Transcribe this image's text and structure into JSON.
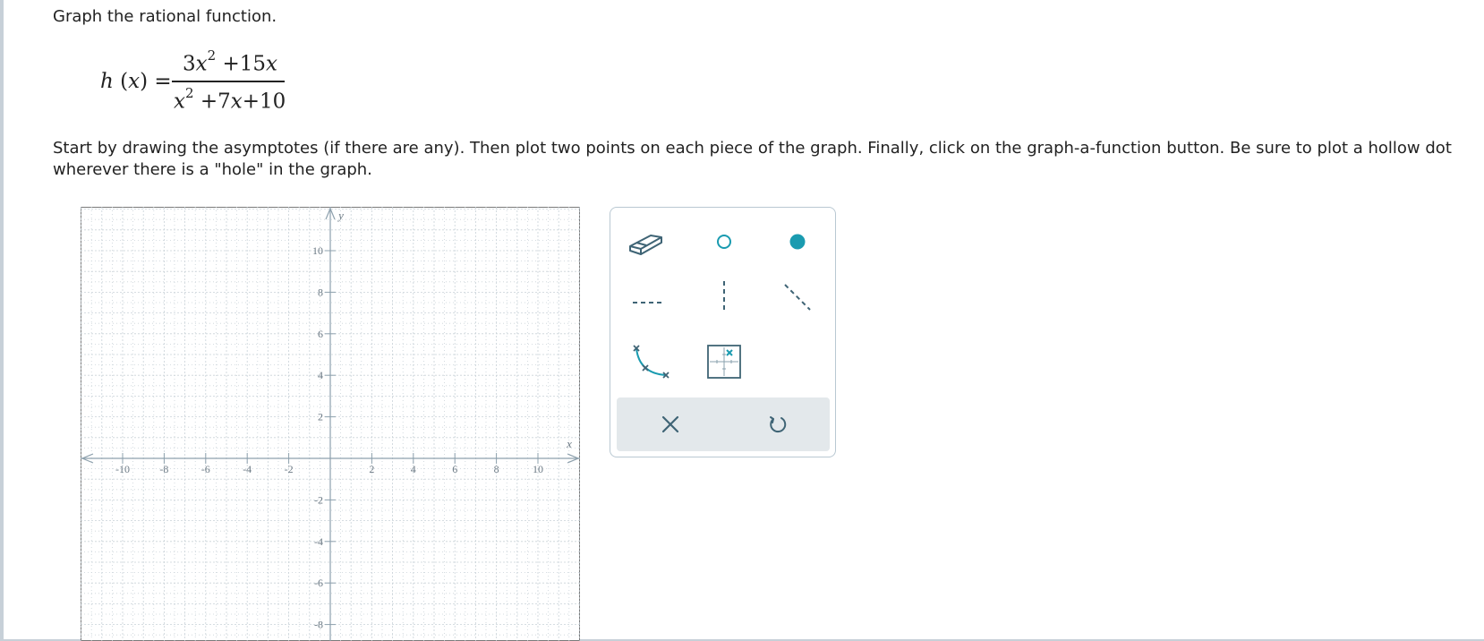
{
  "question": {
    "prompt": "Graph the rational function.",
    "function": {
      "lhs_name": "h",
      "lhs_var": "x",
      "numerator": {
        "coef1": "3",
        "var": "x",
        "exp": "2",
        "rest": "+15",
        "var2": "x"
      },
      "denominator": {
        "var": "x",
        "exp": "2",
        "rest": "+7",
        "var2": "x",
        "const": "+10"
      }
    },
    "instructions": "Start by drawing the asymptotes (if there are any). Then plot two points on each piece of the graph. Finally, click on the graph-a-function button. Be sure to plot a hollow dot wherever there is a \"hole\" in the graph."
  },
  "graph": {
    "x_axis_label": "x",
    "y_axis_label": "y",
    "x_range": [
      -12,
      12
    ],
    "y_range_visible": [
      -9,
      11
    ],
    "x_tick_labels": [
      "-10",
      "-8",
      "-6",
      "-4",
      "-2",
      "2",
      "4",
      "6",
      "8",
      "10"
    ],
    "y_tick_labels": [
      "10",
      "8",
      "6",
      "4",
      "2",
      "-2",
      "-4",
      "-6",
      "-8"
    ],
    "grid": true,
    "grid_color": "#c9d2d8",
    "axis_color": "#8da0ad"
  },
  "tools": {
    "eraser": "eraser-icon",
    "open_point": "open-circle-icon",
    "closed_point": "filled-circle-icon",
    "horizontal_asymptote": "dashed-horizontal-line-icon",
    "vertical_asymptote": "dashed-vertical-line-icon",
    "slant_asymptote": "dashed-diagonal-line-icon",
    "graph_function": "curve-through-points-icon",
    "plot_on_grid": "grid-point-icon",
    "clear": "close-x-icon",
    "undo": "undo-icon"
  },
  "colors": {
    "accent": "#1a9bb0",
    "tool_icon": "#3f6475",
    "panel_border": "#b9c8d2",
    "action_bar": "#e3e8eb"
  }
}
